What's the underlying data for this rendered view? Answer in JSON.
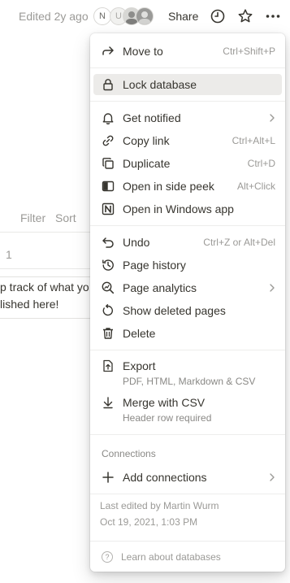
{
  "topbar": {
    "edited": "Edited 2y ago",
    "avatar_initials": [
      "N",
      "U"
    ],
    "share_label": "Share",
    "icons": [
      "clock-icon",
      "star-icon",
      "more-icon"
    ]
  },
  "background": {
    "filter_label": "Filter",
    "sort_label": "Sort",
    "row_number": "1",
    "card_text_line1": "p track of what yo",
    "card_text_line2": "lished here!"
  },
  "menu": {
    "move_to": {
      "label": "Move to",
      "shortcut": "Ctrl+Shift+P"
    },
    "lock_database": {
      "label": "Lock database"
    },
    "get_notified": {
      "label": "Get notified"
    },
    "copy_link": {
      "label": "Copy link",
      "shortcut": "Ctrl+Alt+L"
    },
    "duplicate": {
      "label": "Duplicate",
      "shortcut": "Ctrl+D"
    },
    "open_side_peek": {
      "label": "Open in side peek",
      "shortcut": "Alt+Click"
    },
    "open_windows_app": {
      "label": "Open in Windows app"
    },
    "undo": {
      "label": "Undo",
      "shortcut": "Ctrl+Z or Alt+Del"
    },
    "page_history": {
      "label": "Page history"
    },
    "page_analytics": {
      "label": "Page analytics"
    },
    "show_deleted": {
      "label": "Show deleted pages"
    },
    "delete": {
      "label": "Delete"
    },
    "export": {
      "label": "Export",
      "sub": "PDF, HTML, Markdown & CSV"
    },
    "merge_csv": {
      "label": "Merge with CSV",
      "sub": "Header row required"
    },
    "connections_heading": "Connections",
    "add_connections": {
      "label": "Add connections"
    },
    "last_edited_by": "Last edited by Martin Wurm",
    "last_edited_date": "Oct 19, 2021, 1:03 PM",
    "learn_link": "Learn about databases",
    "highlight_color": "#ecebe9"
  }
}
